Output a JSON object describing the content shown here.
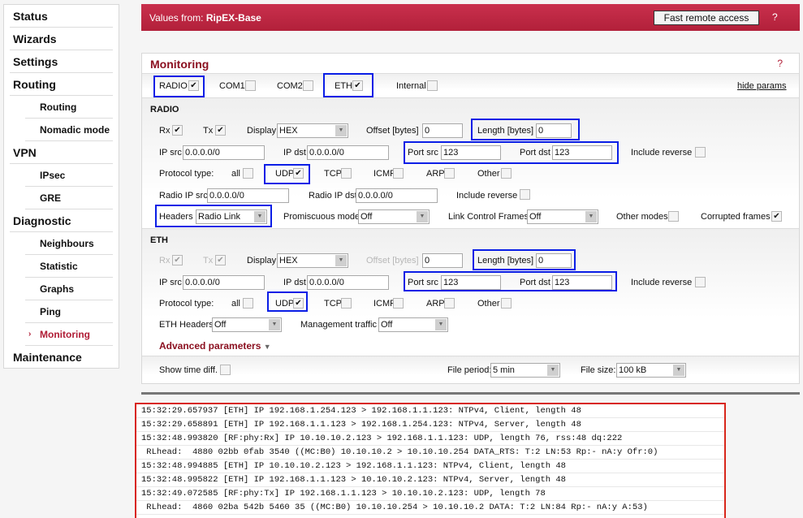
{
  "sidebar": {
    "items": [
      {
        "label": "Status",
        "level": "top"
      },
      {
        "label": "Wizards",
        "level": "top"
      },
      {
        "label": "Settings",
        "level": "top"
      },
      {
        "label": "Routing",
        "level": "top"
      },
      {
        "label": "Routing",
        "level": "sub"
      },
      {
        "label": "Nomadic mode",
        "level": "sub"
      },
      {
        "label": "VPN",
        "level": "top"
      },
      {
        "label": "IPsec",
        "level": "sub"
      },
      {
        "label": "GRE",
        "level": "sub"
      },
      {
        "label": "Diagnostic",
        "level": "top"
      },
      {
        "label": "Neighbours",
        "level": "sub"
      },
      {
        "label": "Statistic",
        "level": "sub"
      },
      {
        "label": "Graphs",
        "level": "sub"
      },
      {
        "label": "Ping",
        "level": "sub"
      },
      {
        "label": "Monitoring",
        "level": "sub",
        "active": true
      },
      {
        "label": "Maintenance",
        "level": "top"
      }
    ],
    "active_marker": "›"
  },
  "header": {
    "values_from_label": "Values from:",
    "station_name": "RipEX-Base",
    "fast_remote_access": "Fast remote access",
    "help": "?"
  },
  "monitoring": {
    "title": "Monitoring",
    "help": "?",
    "interfaces": [
      {
        "label": "RADIO",
        "checked": true
      },
      {
        "label": "COM1",
        "checked": false
      },
      {
        "label": "COM2",
        "checked": false
      },
      {
        "label": "ETH",
        "checked": true
      },
      {
        "label": "Internal",
        "checked": false
      }
    ],
    "hide_params": "hide params",
    "radio": {
      "title": "RADIO",
      "rx_label": "Rx",
      "rx_checked": true,
      "tx_label": "Tx",
      "tx_checked": true,
      "display_label": "Display",
      "display_value": "HEX",
      "offset_label": "Offset [bytes]",
      "offset_value": "0",
      "length_label": "Length [bytes]",
      "length_value": "0",
      "ip_src_label": "IP src",
      "ip_src_value": "0.0.0.0/0",
      "ip_dst_label": "IP dst",
      "ip_dst_value": "0.0.0.0/0",
      "port_src_label": "Port src",
      "port_src_value": "123",
      "port_dst_label": "Port dst",
      "port_dst_value": "123",
      "include_reverse_label": "Include reverse",
      "include_reverse": false,
      "protocol_label": "Protocol type:",
      "protocols": [
        {
          "label": "all",
          "checked": false
        },
        {
          "label": "UDP",
          "checked": true
        },
        {
          "label": "TCP",
          "checked": false
        },
        {
          "label": "ICMP",
          "checked": false
        },
        {
          "label": "ARP",
          "checked": false
        },
        {
          "label": "Other",
          "checked": false
        }
      ],
      "radio_ip_src_label": "Radio IP src",
      "radio_ip_src_value": "0.0.0.0/0",
      "radio_ip_dst_label": "Radio IP dst",
      "radio_ip_dst_value": "0.0.0.0/0",
      "radio_include_reverse_label": "Include reverse",
      "radio_include_reverse": false,
      "headers_label": "Headers",
      "headers_value": "Radio Link",
      "promiscuous_label": "Promiscuous mode",
      "promiscuous_value": "Off",
      "link_control_label": "Link Control Frames",
      "link_control_value": "Off",
      "other_modes_label": "Other modes",
      "other_modes": false,
      "corrupted_label": "Corrupted frames",
      "corrupted": true
    },
    "eth": {
      "title": "ETH",
      "rx_label": "Rx",
      "rx_checked": true,
      "tx_label": "Tx",
      "tx_checked": true,
      "display_label": "Display",
      "display_value": "HEX",
      "offset_label": "Offset [bytes]",
      "offset_value": "0",
      "length_label": "Length [bytes]",
      "length_value": "0",
      "ip_src_label": "IP src",
      "ip_src_value": "0.0.0.0/0",
      "ip_dst_label": "IP dst",
      "ip_dst_value": "0.0.0.0/0",
      "port_src_label": "Port src",
      "port_src_value": "123",
      "port_dst_label": "Port dst",
      "port_dst_value": "123",
      "include_reverse_label": "Include reverse",
      "include_reverse": false,
      "protocol_label": "Protocol type:",
      "protocols": [
        {
          "label": "all",
          "checked": false
        },
        {
          "label": "UDP",
          "checked": true
        },
        {
          "label": "TCP",
          "checked": false
        },
        {
          "label": "ICMP",
          "checked": false
        },
        {
          "label": "ARP",
          "checked": false
        },
        {
          "label": "Other",
          "checked": false
        }
      ],
      "eth_headers_label": "ETH Headers",
      "eth_headers_value": "Off",
      "mgmt_traffic_label": "Management traffic",
      "mgmt_traffic_value": "Off"
    },
    "advanced_parameters": "Advanced parameters",
    "show_time_diff_label": "Show time diff.",
    "show_time_diff": false,
    "file_period_label": "File period:",
    "file_period_value": "5 min",
    "file_size_label": "File size:",
    "file_size_value": "100 kB"
  },
  "log": {
    "lines": [
      "15:32:29.657937 [ETH] IP 192.168.1.254.123 > 192.168.1.1.123: NTPv4, Client, length 48",
      "15:32:29.658891 [ETH] IP 192.168.1.1.123 > 192.168.1.254.123: NTPv4, Server, length 48",
      "15:32:48.993820 [RF:phy:Rx] IP 10.10.10.2.123 > 192.168.1.1.123: UDP, length 76, rss:48 dq:222",
      " RLhead:  4880 02bb 0fab 3540 ((MC:B0) 10.10.10.2 > 10.10.10.254 DATA_RTS: T:2 LN:53 Rp:- nA:y Ofr:0)",
      "15:32:48.994885 [ETH] IP 10.10.10.2.123 > 192.168.1.1.123: NTPv4, Client, length 48",
      "15:32:48.995822 [ETH] IP 192.168.1.1.123 > 10.10.10.2.123: NTPv4, Server, length 48",
      "15:32:49.072585 [RF:phy:Tx] IP 192.168.1.1.123 > 10.10.10.2.123: UDP, length 78",
      " RLhead:  4860 02ba 542b 5460 35 ((MC:B0) 10.10.10.254 > 10.10.10.2 DATA: T:2 LN:84 Rp:- nA:y A:53)"
    ]
  },
  "colors": {
    "brand": "#b8223e",
    "title": "#8b1020",
    "highlight_box": "#0a1ee6",
    "log_border": "#d8261a"
  }
}
